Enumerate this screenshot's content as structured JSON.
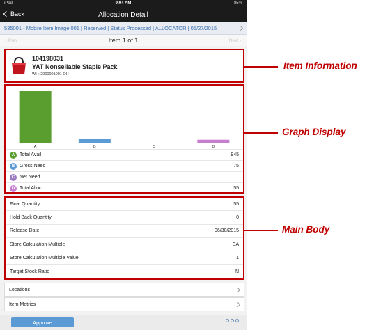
{
  "status_bar": {
    "carrier": "iPad",
    "time": "9:04 AM",
    "battery": "85%"
  },
  "nav": {
    "back_label": "Back",
    "title": "Allocation Detail"
  },
  "context": {
    "text": "535001 - Mobile Item Image 001 | Reserved | Status Processed | ALLOCATOR | 05/27/2015"
  },
  "pager": {
    "prev_label": "Prev",
    "position": "Item 1 of 1",
    "next_label": "Next"
  },
  "item": {
    "number": "104198031",
    "name": "YAT Nonsellable Staple Pack",
    "warehouse": "WH: 2000001001 OH"
  },
  "chart_data": {
    "type": "bar",
    "categories": [
      "A",
      "B",
      "C",
      "D"
    ],
    "values": [
      945,
      75,
      0,
      55
    ],
    "colors": [
      "#5a9e2f",
      "#5b9bd5",
      "#9e7cc1",
      "#c77fd0"
    ],
    "ylim": [
      0,
      945
    ]
  },
  "legend": [
    {
      "letter": "A",
      "label": "Total Avail",
      "value": "945",
      "color": "#5a9e2f"
    },
    {
      "letter": "B",
      "label": "Gross Need",
      "value": "75",
      "color": "#5b9bd5"
    },
    {
      "letter": "C",
      "label": "Net Need",
      "value": "",
      "color": "#9e7cc1"
    },
    {
      "letter": "D",
      "label": "Total Alloc",
      "value": "55",
      "color": "#c77fd0"
    }
  ],
  "main_body": [
    {
      "label": "Final Quantity",
      "value": "55"
    },
    {
      "label": "Hold Back Quantity",
      "value": "0"
    },
    {
      "label": "Release Date",
      "value": "06/30/2015"
    },
    {
      "label": "Store Calculation Multiple",
      "value": "EA"
    },
    {
      "label": "Store Calculation Multiple Value",
      "value": "1"
    },
    {
      "label": "Target Stock Ratio",
      "value": "N"
    }
  ],
  "links": {
    "locations": "Locations",
    "item_metrics": "Item Metrics"
  },
  "footer": {
    "approve_label": "Approve"
  },
  "callouts": {
    "item_information": "Item Information",
    "graph_display": "Graph Display",
    "main_body": "Main Body"
  }
}
